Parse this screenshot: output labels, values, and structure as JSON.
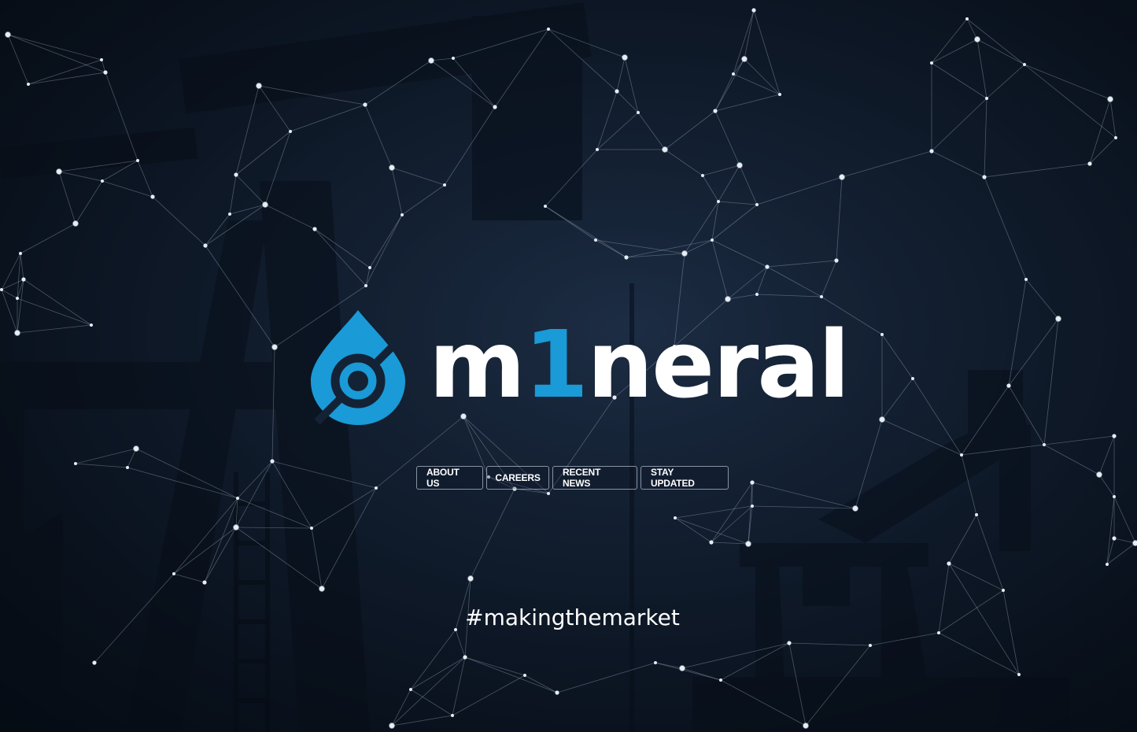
{
  "brand": {
    "name_prefix": "m",
    "name_accent": "1",
    "name_suffix": "neral",
    "icon": "droplet-target-icon",
    "accent_color": "#1a9ad7",
    "text_color": "#ffffff"
  },
  "background": {
    "color": "#142236",
    "scene": "oil-pump-jack-silhouettes",
    "overlay": "network-constellation"
  },
  "nav": {
    "items": [
      {
        "label": "ABOUT US"
      },
      {
        "label": "CAREERS"
      },
      {
        "label": "RECENT NEWS"
      },
      {
        "label": "STAY UPDATED"
      }
    ]
  },
  "tagline": "#makingthemarket"
}
